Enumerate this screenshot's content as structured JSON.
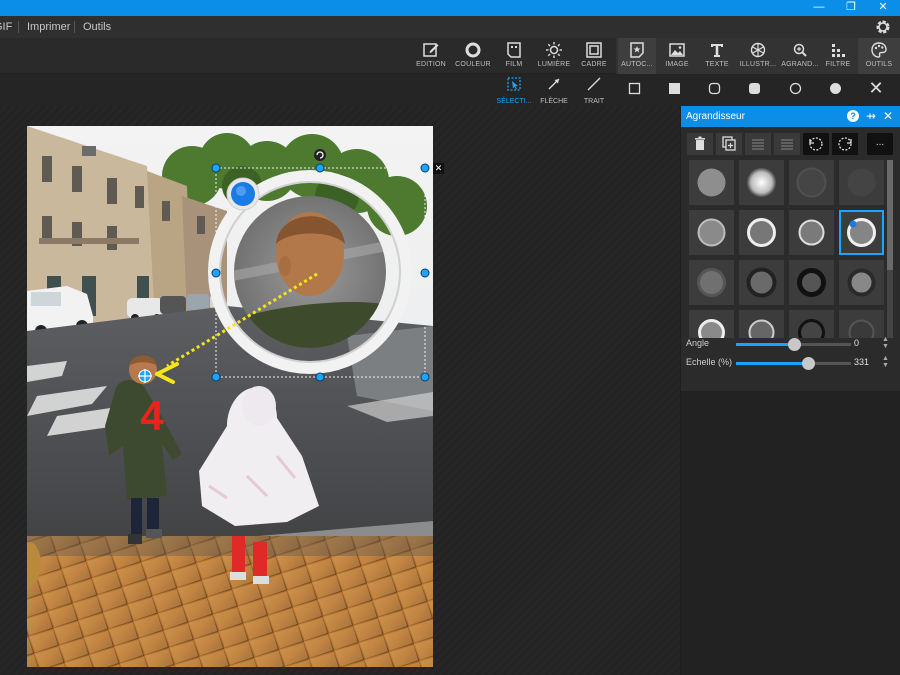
{
  "window": {
    "minimize": "—",
    "restore": "❐",
    "close": "✕"
  },
  "menu": {
    "items": [
      "GIF",
      "Imprimer",
      "Outils"
    ]
  },
  "toolbar": {
    "tools": [
      {
        "label": "EDITION",
        "icon": "edit-icon"
      },
      {
        "label": "COULEUR",
        "icon": "color-ring-icon"
      },
      {
        "label": "FILM",
        "icon": "film-icon"
      },
      {
        "label": "LUMIÈRE",
        "icon": "sun-icon"
      },
      {
        "label": "CADRE",
        "icon": "frame-icon"
      },
      {
        "label": "AUTOC...",
        "icon": "sticker-icon"
      },
      {
        "label": "IMAGE",
        "icon": "image-icon"
      },
      {
        "label": "TEXTE",
        "icon": "text-icon"
      },
      {
        "label": "ILLUSTR...",
        "icon": "illustration-icon"
      },
      {
        "label": "AGRAND...",
        "icon": "magnifier-icon"
      },
      {
        "label": "FILTRE",
        "icon": "filter-icon"
      },
      {
        "label": "OUTILS",
        "icon": "palette-icon"
      }
    ]
  },
  "subbar": {
    "tools": [
      {
        "label": "SÉLECTI...",
        "icon": "select-icon"
      },
      {
        "label": "FLÈCHE",
        "icon": "arrow-icon"
      },
      {
        "label": "TRAIT",
        "icon": "line-icon"
      }
    ],
    "shapes": [
      "square-outline-icon",
      "square-filled-icon",
      "rounded-outline-icon",
      "rounded-filled-icon",
      "circle-outline-icon",
      "circle-filled-icon"
    ],
    "close": "✕"
  },
  "canvas": {
    "overlay_number": "4"
  },
  "panel": {
    "title": "Agrandisseur",
    "help": "?",
    "pin": "⇸",
    "close": "✕",
    "more": "...",
    "angle": {
      "label": "Angle",
      "value": "0",
      "fraction": 0.5
    },
    "scale": {
      "label": "Echelle (%)",
      "value": "331",
      "fraction": 0.63
    }
  },
  "colors": {
    "accent": "#0a8ee8",
    "selection_blue": "#1aa6ff",
    "arrow_yellow": "#f5e616",
    "number_red": "#e8241c"
  }
}
